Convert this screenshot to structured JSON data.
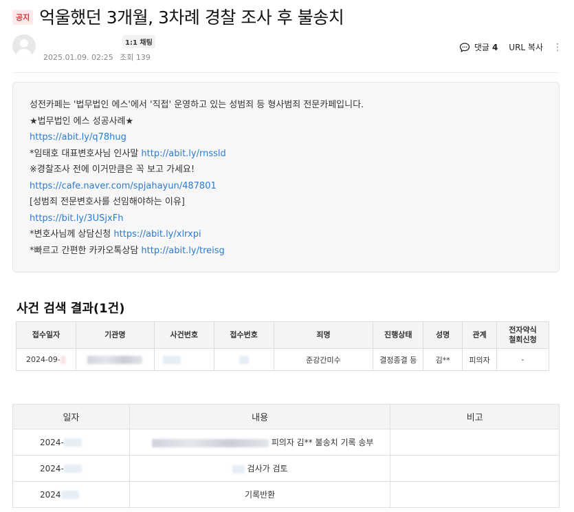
{
  "post": {
    "badge": "공지",
    "title": "억울했던 3개월, 3차례 경찰 조사 후 불송치",
    "chat_tag": "1:1 채팅",
    "date": "2025.01.09. 02:25",
    "views": "조회 139",
    "comment_label": "댓글",
    "comment_count": "4",
    "url_copy": "URL 복사",
    "more": "⋮"
  },
  "notice": {
    "line1": "성전카페는 '법무법인 에스'에서 '직접' 운영하고 있는 성범죄 등 형사범죄 전문카페입니다.",
    "line2": "★법무법인 에스 성공사례★",
    "line3": "https://abit.ly/q78hug",
    "line4_text": "*임태호 대표변호사님 인사말 ",
    "line4_link": "http://abit.ly/rnssld",
    "line5": "※경찰조사 전에 이거만큼은 꼭 보고 가세요!",
    "line6": "https://cafe.naver.com/spjahayun/487801",
    "line7": "[성범죄 전문변호사를 선임해야하는 이유]",
    "line8": "https://bit.ly/3USjxFh",
    "line9_text": "*변호사님께 상담신청 ",
    "line9_link": "https://abit.ly/xlrxpi",
    "line10_text": "*빠르고 간편한 카카오톡상담 ",
    "line10_link": "http://abit.ly/treisg"
  },
  "case_search": {
    "title": "사건 검색 결과(1건)",
    "headers": [
      "접수일자",
      "기관명",
      "사건번호",
      "접수번호",
      "죄명",
      "진행상태",
      "성명",
      "관계",
      "전자약식\n철회신청"
    ],
    "row": {
      "date": "2024-09-",
      "crime": "준강간미수",
      "status": "결정종결 등",
      "name": "김**",
      "relation": "피의자",
      "withdraw": "-"
    }
  },
  "history": {
    "headers": [
      "일자",
      "내용",
      "비고"
    ],
    "rows": [
      {
        "date": "2024-",
        "content": "피의자 김** 불송치 기록 송부",
        "note": ""
      },
      {
        "date": "2024-",
        "content": "검사가 검토",
        "note": ""
      },
      {
        "date": "2024",
        "content": "기록반환",
        "note": ""
      }
    ]
  }
}
